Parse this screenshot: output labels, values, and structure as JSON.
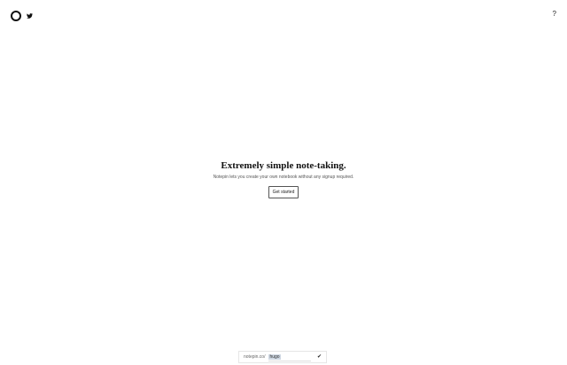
{
  "header": {
    "logo_icon": "circle-logo-icon",
    "social_icon": "twitter-icon",
    "help_label": "?"
  },
  "hero": {
    "title": "Extremely simple note-taking.",
    "subtitle": "Notepin lets you create your own notebook without any signup required.",
    "cta_label": "Get started"
  },
  "url_bar": {
    "prefix": "notepin.co/",
    "value": "hugo",
    "submit_icon": "checkmark-icon",
    "submit_label": "✔"
  }
}
